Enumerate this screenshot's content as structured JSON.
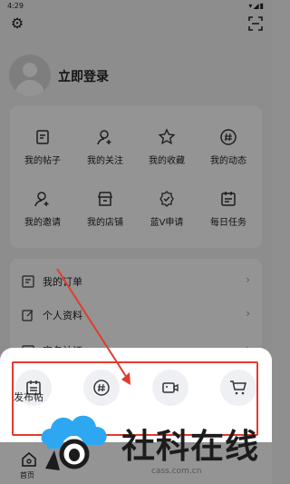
{
  "status_bar": {
    "time": "4:29",
    "system_icons": "▾◢▮"
  },
  "profile": {
    "login_label": "立即登录"
  },
  "grid": {
    "items": [
      {
        "label": "我的帖子",
        "icon": "post-icon"
      },
      {
        "label": "我的关注",
        "icon": "follow-icon"
      },
      {
        "label": "我的收藏",
        "icon": "star-icon"
      },
      {
        "label": "我的动态",
        "icon": "hashtag-icon"
      },
      {
        "label": "我的邀请",
        "icon": "invite-icon"
      },
      {
        "label": "我的店铺",
        "icon": "store-icon"
      },
      {
        "label": "蓝V申请",
        "icon": "verified-icon"
      },
      {
        "label": "每日任务",
        "icon": "calendar-icon"
      }
    ]
  },
  "list": {
    "rows": [
      {
        "label": "我的订单",
        "icon": "order-icon"
      },
      {
        "label": "个人资料",
        "icon": "edit-icon"
      },
      {
        "label": "实名认证",
        "icon": "id-icon"
      }
    ]
  },
  "sheet": {
    "actions": [
      {
        "icon": "calendar-post-icon"
      },
      {
        "icon": "hashtag-chat-icon"
      },
      {
        "icon": "video-icon"
      },
      {
        "icon": "cart-icon"
      }
    ],
    "first_label": "发布帖"
  },
  "bottom_nav": {
    "home_label": "首页"
  },
  "watermark": {
    "brand": "社科在线",
    "url": "cass.com.cn"
  },
  "colors": {
    "highlight": "#e23b2e",
    "watermark_blue": "#2ea7f2"
  }
}
